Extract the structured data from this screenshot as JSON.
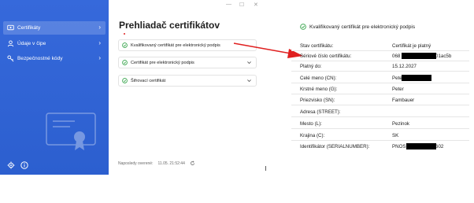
{
  "window": {
    "minimize": "—",
    "maximize": "☐",
    "close": "✕"
  },
  "sidebar": {
    "items": [
      {
        "label": "Certifikáty",
        "icon": "certificate-icon",
        "active": true
      },
      {
        "label": "Údaje v čipe",
        "icon": "chip-data-icon",
        "active": false
      },
      {
        "label": "Bezpečnostné kódy",
        "icon": "key-icon",
        "active": false
      }
    ],
    "footer_icons": [
      "settings-icon",
      "info-icon"
    ]
  },
  "main": {
    "title": "Prehliadač certifikátov",
    "certificates": [
      {
        "label": "Kvalifikovaný certifikát pre elektronický podpis",
        "status": "valid"
      },
      {
        "label": "Certifikát pre elektronický podpis",
        "status": "valid"
      },
      {
        "label": "Šifrovací certifikát",
        "status": "valid"
      }
    ],
    "last_check_label": "Naposledy overené:",
    "last_check_value": "11.05. 21:52:44"
  },
  "detail": {
    "title": "Kvalifikovaný certifikát pre elektronický podpis",
    "rows": [
      {
        "label": "Stav certifikátu:",
        "value": "Certifikát je platný"
      },
      {
        "label": "Sériové číslo certifikátu:",
        "value": "068",
        "value_tail": "01ac5b"
      },
      {
        "label": "Platný do:",
        "value": "15.12.2027"
      },
      {
        "label": "Celé meno (CN):",
        "value": "Pete"
      },
      {
        "label": "Krstné meno (G):",
        "value": "Peter"
      },
      {
        "label": "Priezvisko (SN):",
        "value": "Fambauer"
      },
      {
        "label": "Adresa (STREET):",
        "value": ""
      },
      {
        "label": "Mesto (L):",
        "value": "Pezinok"
      },
      {
        "label": "Krajina (C):",
        "value": "SK"
      },
      {
        "label": "Identifikátor (SERIALNUMBER):",
        "value": "PNOS",
        "value_tail": "602"
      }
    ]
  },
  "colors": {
    "sidebar_blue": "#2f63d6",
    "success_green": "#2ea043",
    "annotation_red": "#e02020"
  }
}
